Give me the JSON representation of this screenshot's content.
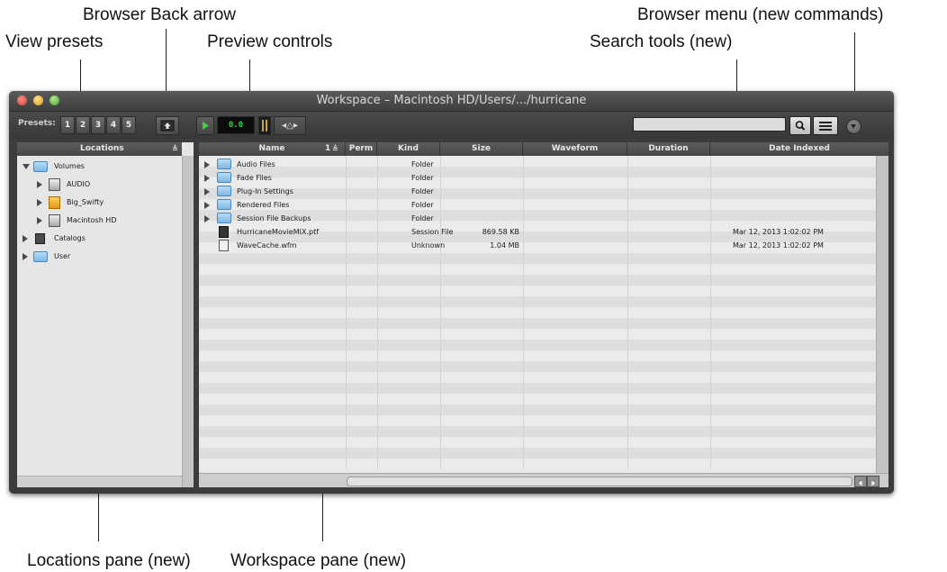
{
  "callouts": {
    "browser_back_arrow": "Browser Back arrow",
    "view_presets": "View presets",
    "preview_controls": "Preview controls",
    "browser_menu": "Browser menu (new commands)",
    "search_tools": "Search tools (new)",
    "locations_pane": "Locations pane (new)",
    "workspace_pane": "Workspace pane (new)"
  },
  "window": {
    "title": "Workspace – Macintosh HD/Users/.../hurricane"
  },
  "toolbar": {
    "presets_label": "Presets:",
    "preset_buttons": [
      "1",
      "2",
      "3",
      "4",
      "5"
    ],
    "preview_level": "0.0",
    "search_placeholder": ""
  },
  "locations": {
    "header": "Locations",
    "items": [
      {
        "label": "Volumes",
        "icon": "folder-icon"
      },
      {
        "label": "AUDIO",
        "icon": "drive-icon"
      },
      {
        "label": "Big_Swifty",
        "icon": "drive-icon"
      },
      {
        "label": "Macintosh HD",
        "icon": "drive-icon"
      },
      {
        "label": "Catalogs",
        "icon": "catalog-icon"
      },
      {
        "label": "User",
        "icon": "folder-icon"
      }
    ]
  },
  "workspace": {
    "columns": [
      "Name",
      "1",
      "Perm",
      "Kind",
      "Size",
      "Waveform",
      "Duration",
      "Date Indexed"
    ],
    "rows": [
      {
        "name": "Audio Files",
        "kind": "Folder",
        "size": "",
        "date": ""
      },
      {
        "name": "Fade Files",
        "kind": "Folder",
        "size": "",
        "date": ""
      },
      {
        "name": "Plug-In Settings",
        "kind": "Folder",
        "size": "",
        "date": ""
      },
      {
        "name": "Rendered Files",
        "kind": "Folder",
        "size": "",
        "date": ""
      },
      {
        "name": "Session File Backups",
        "kind": "Folder",
        "size": "",
        "date": ""
      },
      {
        "name": "HurricaneMovieMIX.ptf",
        "kind": "Session File",
        "size": "869.58 KB",
        "date": "Mar 12, 2013 1:02:02 PM"
      },
      {
        "name": "WaveCache.wfm",
        "kind": "Unknown",
        "size": "1.04 MB",
        "date": "Mar 12, 2013 1:02:02 PM"
      }
    ]
  }
}
